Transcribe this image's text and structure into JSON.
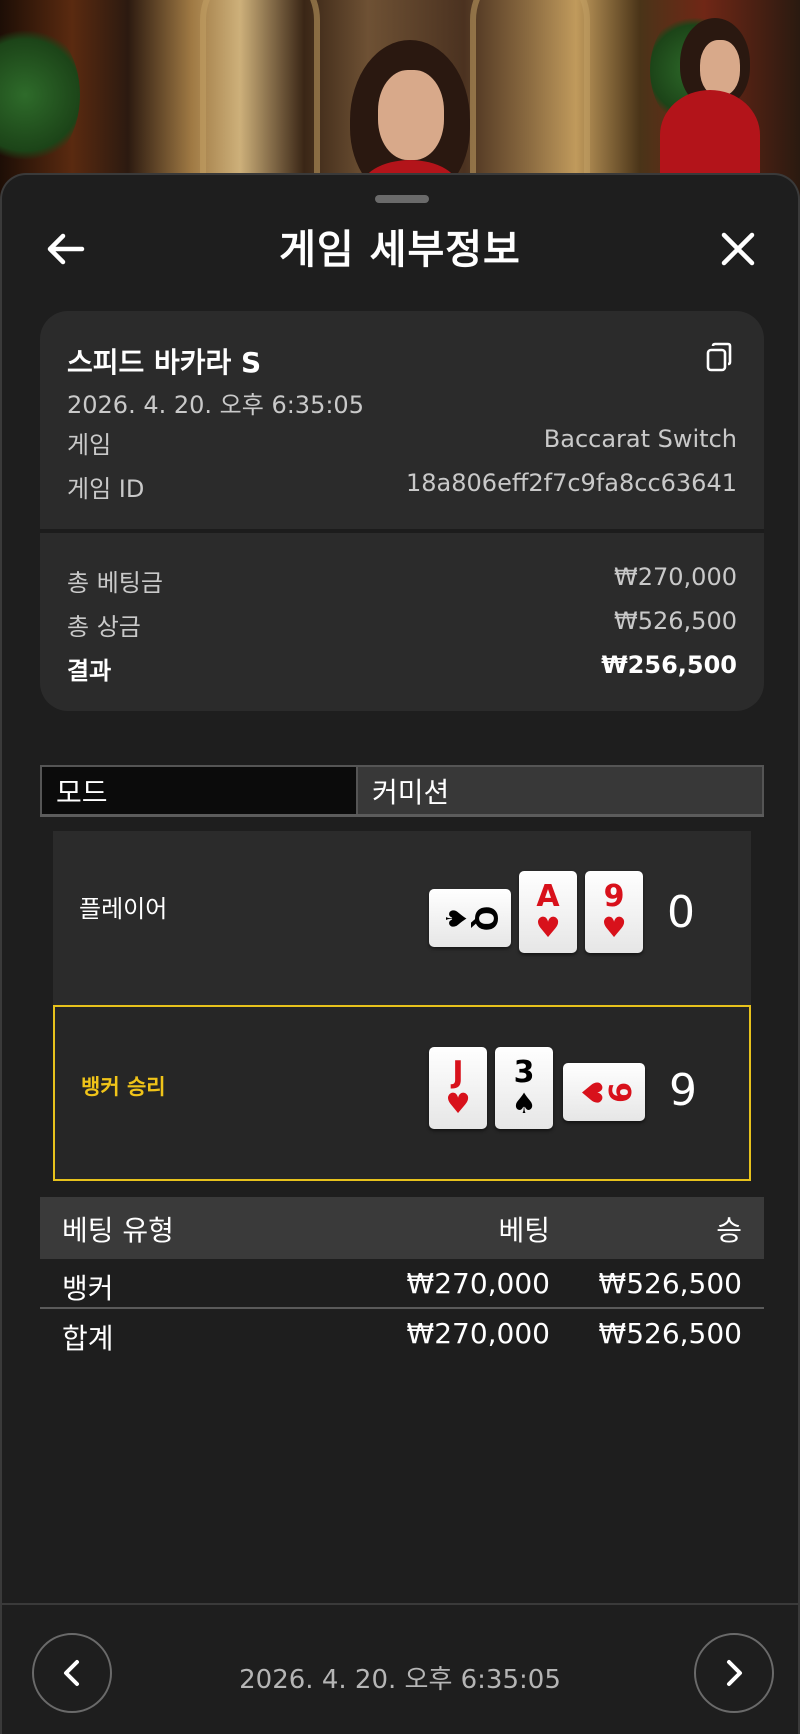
{
  "header": {
    "title": "게임 세부정보",
    "back_icon": "arrow-left-icon",
    "close_icon": "close-icon"
  },
  "summary": {
    "game_name": "스피드 바카라 S",
    "timestamp": "2026. 4. 20. 오후 6:35:05",
    "rows": [
      {
        "label": "게임",
        "value": "Baccarat Switch"
      },
      {
        "label": "게임 ID",
        "value": "18a806eff2f7c9fa8cc63641"
      }
    ],
    "totals": [
      {
        "label": "총 베팅금",
        "value": "₩270,000"
      },
      {
        "label": "총 상금",
        "value": "₩526,500"
      },
      {
        "label": "결과",
        "value": "₩256,500"
      }
    ]
  },
  "tabs": {
    "mode": "모드",
    "commission": "커미션"
  },
  "hands": {
    "player": {
      "label": "플레이어",
      "score": "0",
      "cards": [
        {
          "rank": "Q",
          "suit": "♠",
          "color": "black",
          "orientation": "horizontal"
        },
        {
          "rank": "A",
          "suit": "♥",
          "color": "red",
          "orientation": "vertical"
        },
        {
          "rank": "9",
          "suit": "♥",
          "color": "red",
          "orientation": "vertical"
        }
      ]
    },
    "banker": {
      "label": "뱅커 승리",
      "score": "9",
      "cards": [
        {
          "rank": "J",
          "suit": "♥",
          "color": "red",
          "orientation": "vertical"
        },
        {
          "rank": "3",
          "suit": "♠",
          "color": "black",
          "orientation": "vertical"
        },
        {
          "rank": "9",
          "suit": "♥",
          "color": "red",
          "orientation": "horizontal"
        }
      ]
    }
  },
  "bets_table": {
    "headers": [
      "베팅 유형",
      "베팅",
      "승"
    ],
    "rows": [
      [
        "뱅커",
        "₩270,000",
        "₩526,500"
      ],
      [
        "합계",
        "₩270,000",
        "₩526,500"
      ]
    ]
  },
  "footer": {
    "timestamp": "2026. 4. 20. 오후 6:35:05",
    "prev_icon": "chevron-left-icon",
    "next_icon": "chevron-right-icon"
  },
  "colors": {
    "accent_gold": "#e7c21c",
    "banker_label": "#f0c419",
    "card_red": "#d8111b",
    "sheet_bg": "#1e1e1e",
    "panel_bg": "#2b2b2b"
  }
}
